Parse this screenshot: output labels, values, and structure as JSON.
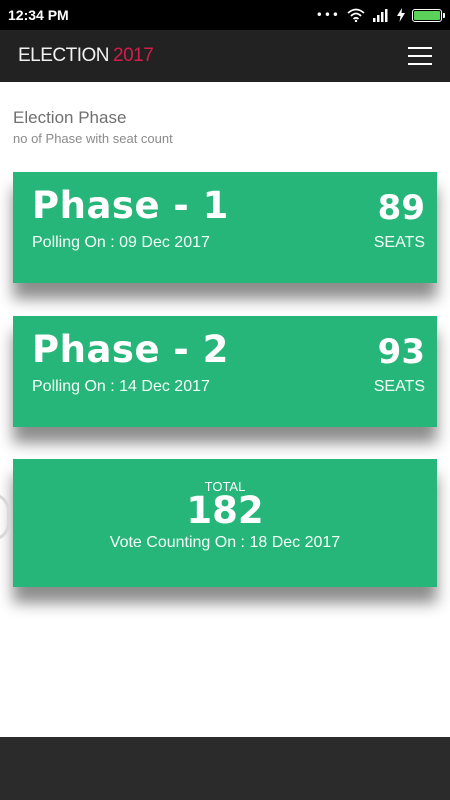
{
  "status_bar": {
    "time": "12:34 PM",
    "icons": [
      "more-dots-icon",
      "wifi-icon",
      "signal-icon",
      "charging-icon",
      "battery-icon"
    ]
  },
  "app_bar": {
    "title_word": "ELECTION",
    "title_year": "2017",
    "title_year_color": "#d31e4a",
    "menu_icon": "hamburger-menu-icon"
  },
  "section": {
    "title": "Election Phase",
    "subtitle": "no of Phase with seat count"
  },
  "phases": [
    {
      "name": "Phase - 1",
      "polling": "Polling On : 09 Dec 2017",
      "seats": "89",
      "seats_label": "SEATS"
    },
    {
      "name": "Phase - 2",
      "polling": "Polling On : 14 Dec 2017",
      "seats": "93",
      "seats_label": "SEATS"
    }
  ],
  "total": {
    "label": "TOTAL",
    "value": "182",
    "counting": "Vote Counting On : 18 Dec 2017"
  },
  "colors": {
    "card": "#27b67a",
    "app_bar": "#222222",
    "status_bar": "#000000",
    "nav_bar": "#2b2b2b"
  }
}
